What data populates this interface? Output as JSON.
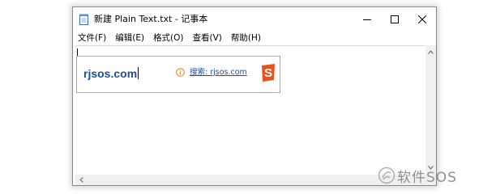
{
  "window": {
    "title": "新建 Plain Text.txt - 记事本",
    "controls": {
      "minimize": "minimize",
      "maximize": "maximize",
      "close": "close"
    }
  },
  "menu": {
    "items": [
      {
        "label": "文件(F)"
      },
      {
        "label": "编辑(E)"
      },
      {
        "label": "格式(O)"
      },
      {
        "label": "查看(V)"
      },
      {
        "label": "帮助(H)"
      }
    ]
  },
  "ime": {
    "composition": "rjsos.com",
    "search_link": "搜索: rjsos.com",
    "logo_letter": "S",
    "logo_color": "#e8521c"
  },
  "watermark": {
    "text": "软件SOS"
  },
  "colors": {
    "link": "#1d4e9c",
    "scrollbar": "#f0f0f0",
    "info_icon": "#d58a2a"
  }
}
